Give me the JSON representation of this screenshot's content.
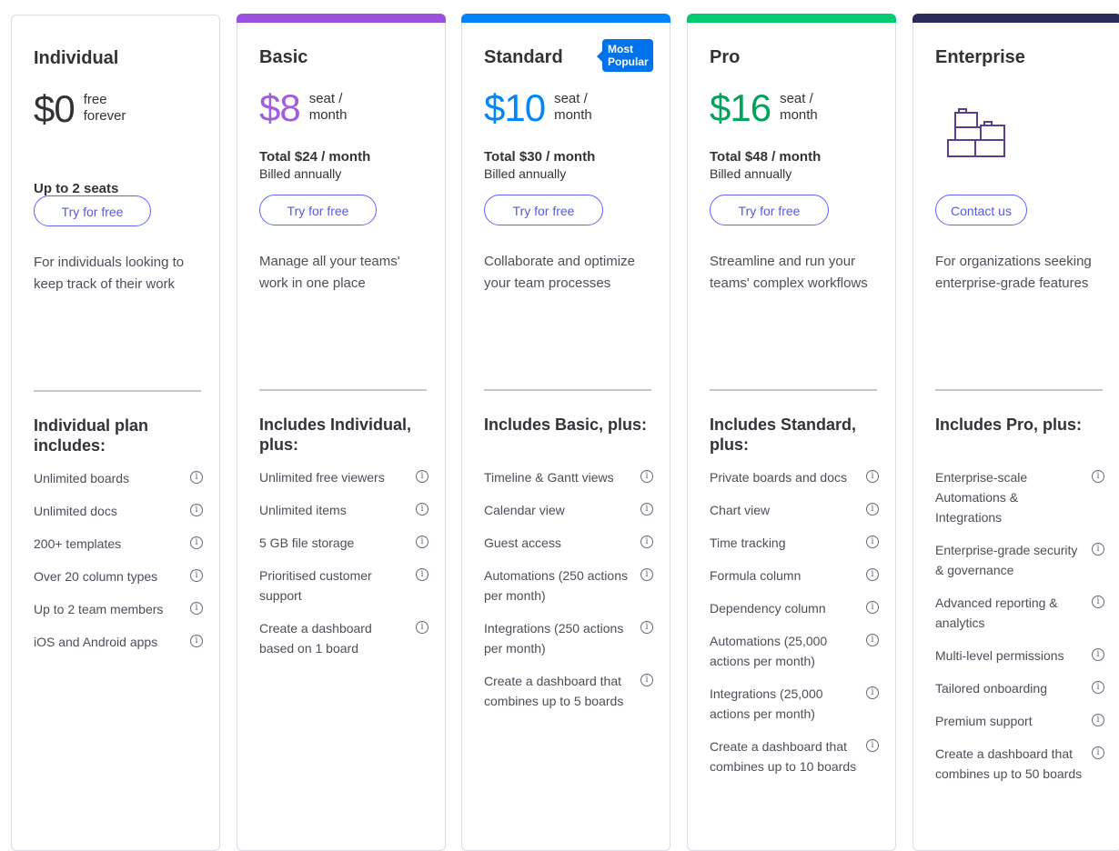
{
  "plans": [
    {
      "name": "Individual",
      "price": "$0",
      "unit_line1": "free",
      "unit_line2": "forever",
      "seats": "Up to 2 seats",
      "cta": "Try for free",
      "description": "For individuals looking to keep track of their work",
      "includes_title": "Individual plan includes:",
      "features": [
        "Unlimited boards",
        "Unlimited docs",
        "200+ templates",
        "Over 20 column types",
        "Up to 2 team members",
        "iOS and Android apps"
      ],
      "accent": "#323338"
    },
    {
      "name": "Basic",
      "price": "$8",
      "unit_line1": "seat /",
      "unit_line2": "month",
      "total": "Total $24 / month",
      "billed": "Billed annually",
      "cta": "Try for free",
      "description": "Manage all your teams' work in one place",
      "includes_title": "Includes Individual, plus:",
      "features": [
        "Unlimited free viewers",
        "Unlimited items",
        "5 GB file storage",
        "Prioritised customer support",
        "Create a dashboard based on 1 board"
      ],
      "accent": "#a25ddc"
    },
    {
      "name": "Standard",
      "badge": "Most Popular",
      "price": "$10",
      "unit_line1": "seat /",
      "unit_line2": "month",
      "total": "Total $30 / month",
      "billed": "Billed annually",
      "cta": "Try for free",
      "description": "Collaborate and optimize your team processes",
      "includes_title": "Includes Basic, plus:",
      "features": [
        "Timeline & Gantt views",
        "Calendar view",
        "Guest access",
        "Automations (250 actions per month)",
        "Integrations (250 actions per month)",
        "Create a dashboard that combines up to 5 boards"
      ],
      "accent": "#0085ff"
    },
    {
      "name": "Pro",
      "price": "$16",
      "unit_line1": "seat /",
      "unit_line2": "month",
      "total": "Total $48 / month",
      "billed": "Billed annually",
      "cta": "Try for free",
      "description": "Streamline and run your teams' complex workflows",
      "includes_title": "Includes Standard, plus:",
      "features": [
        "Private boards and docs",
        "Chart view",
        "Time tracking",
        "Formula column",
        "Dependency column",
        "Automations (25,000 actions per month)",
        "Integrations (25,000 actions per month)",
        "Create a dashboard that combines up to 10 boards"
      ],
      "accent": "#00a359"
    },
    {
      "name": "Enterprise",
      "icon": "building-blocks-icon",
      "cta": "Contact us",
      "description": "For organizations seeking enterprise-grade features",
      "includes_title": "Includes Pro, plus:",
      "features": [
        "Enterprise-scale Automations & Integrations",
        "Enterprise-grade security & governance",
        "Advanced reporting & analytics",
        "Multi-level permissions",
        "Tailored onboarding",
        "Premium support",
        "Create a dashboard that combines up to 50 boards"
      ],
      "accent": "#3b3a66"
    }
  ],
  "colors": {
    "basic_bar": "#9d50dd",
    "standard_bar": "#0085ff",
    "pro_bar": "#00ca72",
    "enterprise_bar": "#2b2c5c",
    "cta_border": "#6161ff",
    "badge": "#0073ea"
  },
  "info_icon": "info-circle-icon"
}
